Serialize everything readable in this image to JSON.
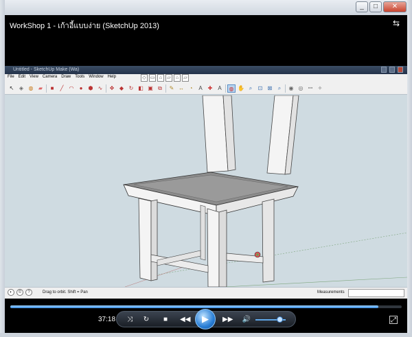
{
  "window": {
    "title": "WorkShop 1 - เก้าอี้แบบง่าย (SketchUp 2013)",
    "controls": [
      "minimize",
      "maximize",
      "close"
    ]
  },
  "sketchup": {
    "title": "Untitled - SketchUp Make (Wa)",
    "menu": [
      "File",
      "Edit",
      "View",
      "Camera",
      "Draw",
      "Tools",
      "Window",
      "Help"
    ],
    "views_toolbar": [
      "iso-icon",
      "top-view-icon",
      "front-view-icon",
      "right-view-icon",
      "back-view-icon",
      "left-view-icon"
    ],
    "tools": [
      "select-icon",
      "make-component-icon",
      "paint-bucket-icon",
      "eraser-icon",
      "rectangle-icon",
      "line-icon",
      "arc-icon",
      "circle-icon",
      "polygon-icon",
      "freehand-icon",
      "move-icon",
      "push-pull-icon",
      "rotate-icon",
      "follow-me-icon",
      "scale-icon",
      "offset-icon",
      "tape-measure-icon",
      "dimension-icon",
      "protractor-icon",
      "text-icon",
      "axes-icon",
      "3d-text-icon",
      "orbit-icon",
      "pan-icon",
      "zoom-icon",
      "zoom-window-icon",
      "zoom-extents-icon",
      "previous-view-icon",
      "position-camera-icon",
      "look-around-icon",
      "walk-icon",
      "section-plane-icon"
    ],
    "active_tool": "orbit-icon",
    "status_text": "Drag to orbit.  Shift = Pan",
    "measurements_label": "Measurements",
    "measurements_value": ""
  },
  "player": {
    "time": "37:18",
    "progress": 0.94,
    "volume": 0.8,
    "buttons": [
      "shuffle-icon",
      "repeat-icon",
      "stop-icon",
      "previous-icon",
      "play-icon",
      "next-icon",
      "mute-icon"
    ]
  },
  "colors": {
    "player_accent": "#3a8be0",
    "viewport_bg": "#cfdbe1",
    "chair_wood": "#f4f4f4",
    "chair_seat": "#8c8c8c"
  }
}
